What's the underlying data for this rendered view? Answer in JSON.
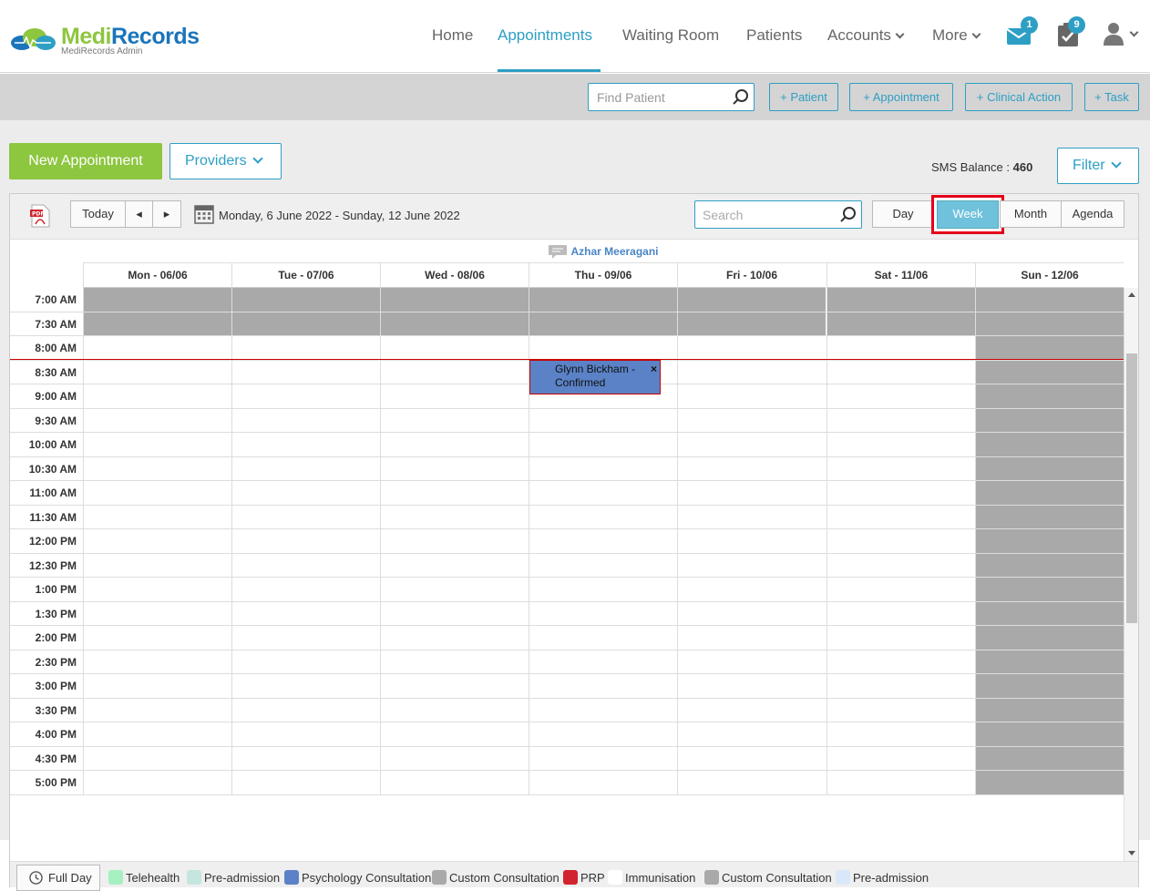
{
  "brand": {
    "name_part1": "Medi",
    "name_part2": "Records",
    "subtitle": "MediRecords Admin"
  },
  "nav": {
    "items": [
      {
        "label": "Home"
      },
      {
        "label": "Appointments",
        "active": true
      },
      {
        "label": "Waiting Room"
      },
      {
        "label": "Patients"
      },
      {
        "label": "Accounts"
      },
      {
        "label": "More"
      }
    ],
    "mail_badge": "1",
    "tasks_badge": "9"
  },
  "actions": {
    "find_placeholder": "Find Patient",
    "patient": "+ Patient",
    "appointment": "+ Appointment",
    "clinical": "+ Clinical Action",
    "task": "+ Task"
  },
  "controls": {
    "new_appointment": "New Appointment",
    "providers": "Providers",
    "sms_label": "SMS Balance :",
    "sms_value": "460",
    "filter": "Filter"
  },
  "toolbar": {
    "today": "Today",
    "prev": "◂",
    "next": "▸",
    "date_range": "Monday, 6 June 2022 - Sunday, 12 June 2022",
    "search_placeholder": "Search",
    "views": [
      {
        "label": "Day"
      },
      {
        "label": "Week",
        "active": true
      },
      {
        "label": "Month"
      },
      {
        "label": "Agenda"
      }
    ]
  },
  "calendar": {
    "provider": "Azhar Meeragani",
    "days": [
      "Mon - 06/06",
      "Tue - 07/06",
      "Wed - 08/06",
      "Thu - 09/06",
      "Fri - 10/06",
      "Sat - 11/06",
      "Sun - 12/06"
    ],
    "times": [
      "7:00 AM",
      "7:30 AM",
      "8:00 AM",
      "8:30 AM",
      "9:00 AM",
      "9:30 AM",
      "10:00 AM",
      "10:30 AM",
      "11:00 AM",
      "11:30 AM",
      "12:00 PM",
      "12:30 PM",
      "1:00 PM",
      "1:30 PM",
      "2:00 PM",
      "2:30 PM",
      "3:00 PM",
      "3:30 PM",
      "4:00 PM",
      "4:30 PM",
      "5:00 PM"
    ],
    "appointment": {
      "text": "Glynn Bickham - Confirmed",
      "close": "×"
    }
  },
  "legend": {
    "full_day": "Full Day",
    "items": [
      {
        "label": "Telehealth",
        "color": "#a6f0c1"
      },
      {
        "label": "Pre-admission",
        "color": "#c5e6df"
      },
      {
        "label": "Psychology Consultation",
        "color": "#5b82c6"
      },
      {
        "label": "Custom Consultation",
        "color": "#a9a9a9"
      },
      {
        "label": "PRP",
        "color": "#d1242e"
      },
      {
        "label": "Immunisation",
        "color": "#ffffff"
      },
      {
        "label": "Custom Consultation",
        "color": "#a9a9a9"
      },
      {
        "label": "Pre-admission",
        "color": "#d9e8f8"
      }
    ]
  }
}
